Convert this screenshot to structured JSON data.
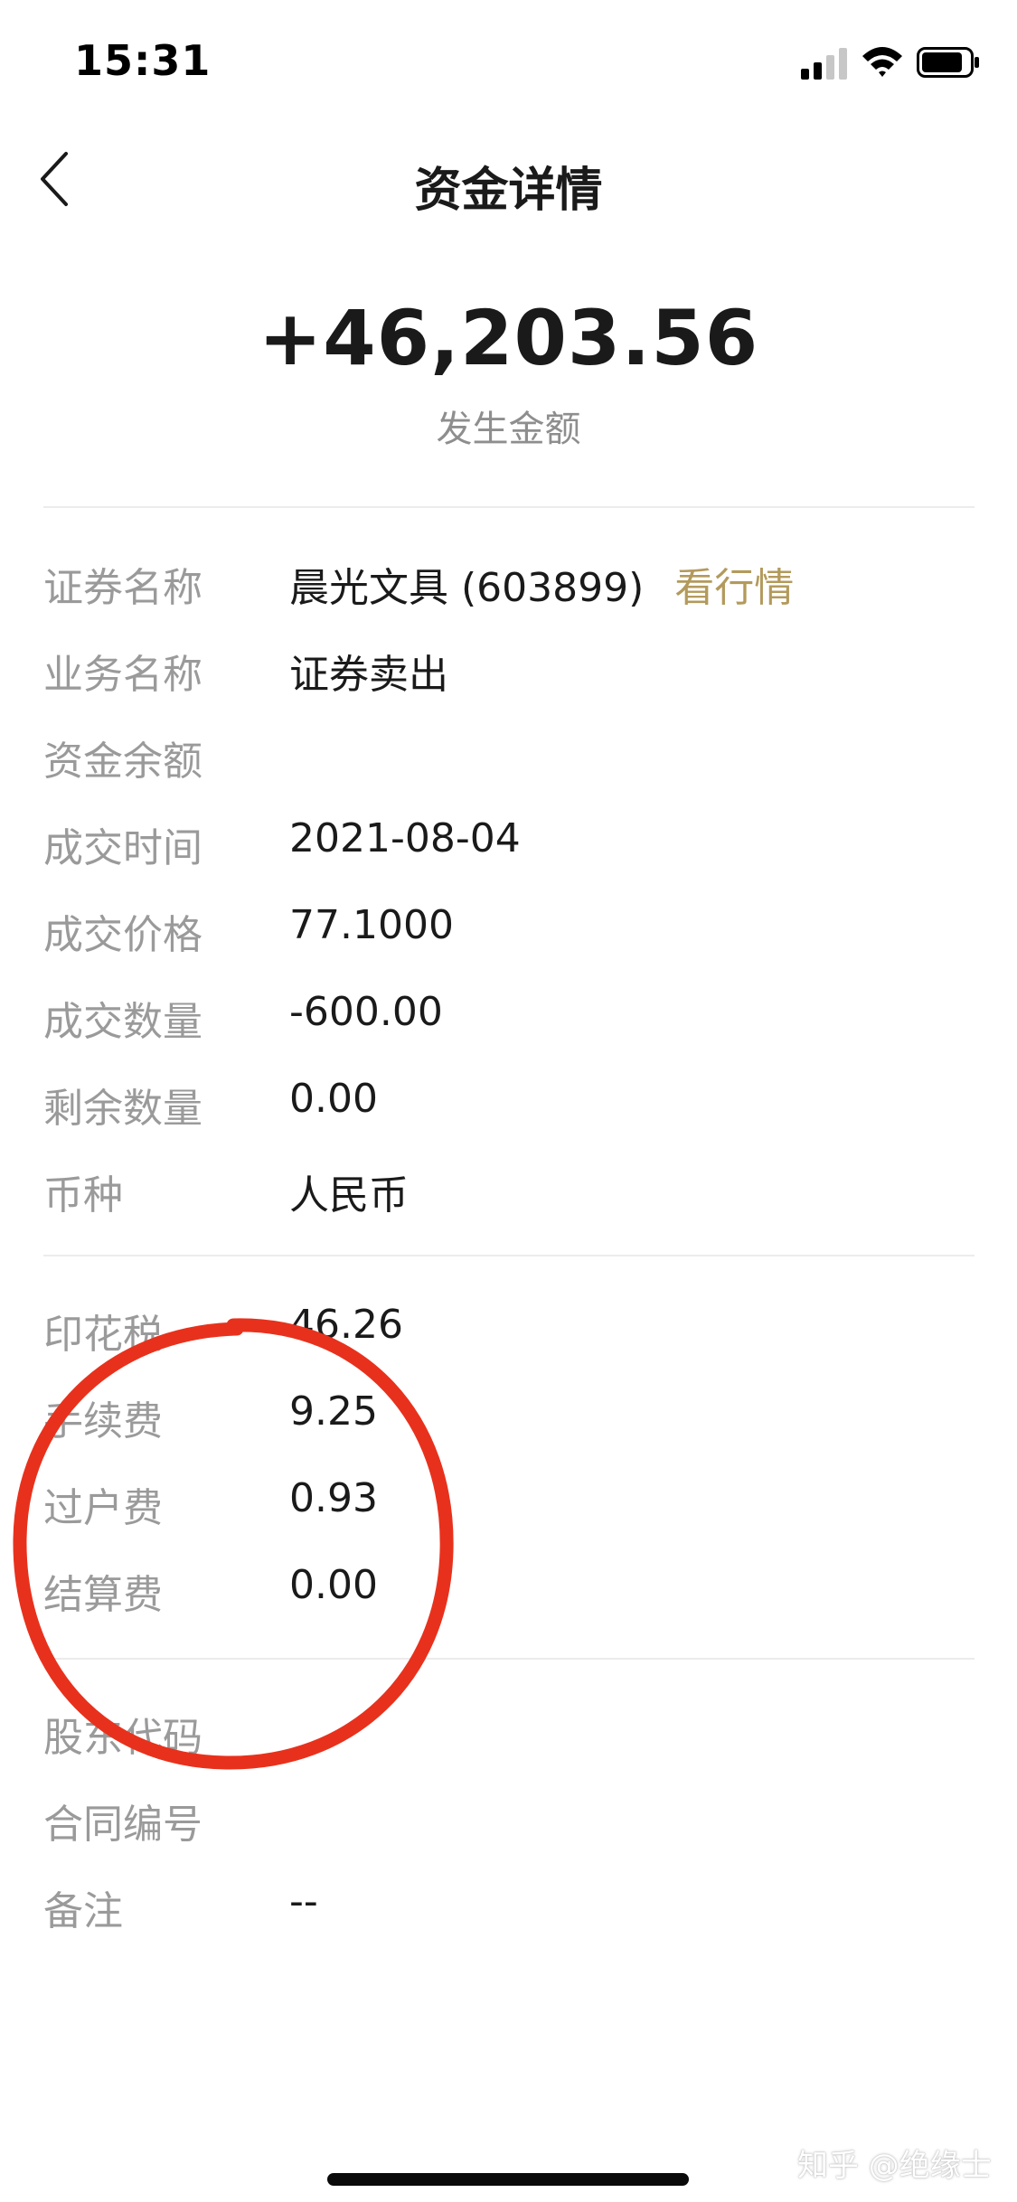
{
  "status_bar": {
    "time": "15:31"
  },
  "nav": {
    "title": "资金详情",
    "back_icon": "chevron-left-icon"
  },
  "header": {
    "amount": "+46,203.56",
    "amount_label": "发生金额"
  },
  "details": {
    "security_name": {
      "label": "证券名称",
      "value": "晨光文具 (603899)",
      "link": "看行情"
    },
    "business_name": {
      "label": "业务名称",
      "value": "证券卖出"
    },
    "fund_balance": {
      "label": "资金余额",
      "value": ""
    },
    "trade_time": {
      "label": "成交时间",
      "value": "2021-08-04"
    },
    "trade_price": {
      "label": "成交价格",
      "value": "77.1000"
    },
    "trade_quantity": {
      "label": "成交数量",
      "value": "-600.00"
    },
    "remaining_quantity": {
      "label": "剩余数量",
      "value": "0.00"
    },
    "currency": {
      "label": "币种",
      "value": "人民币"
    }
  },
  "fees": {
    "stamp_tax": {
      "label": "印花税",
      "value": "46.26"
    },
    "commission": {
      "label": "手续费",
      "value": "9.25"
    },
    "transfer_fee": {
      "label": "过户费",
      "value": "0.93"
    },
    "settlement_fee": {
      "label": "结算费",
      "value": "0.00"
    }
  },
  "extra": {
    "shareholder_code": {
      "label": "股东代码",
      "value": ""
    },
    "contract_number": {
      "label": "合同编号",
      "value": ""
    },
    "remark": {
      "label": "备注",
      "value": "--"
    }
  },
  "annotation": {
    "color": "#e8311c",
    "shape": "circle"
  },
  "watermark": "知乎 @绝缘士"
}
